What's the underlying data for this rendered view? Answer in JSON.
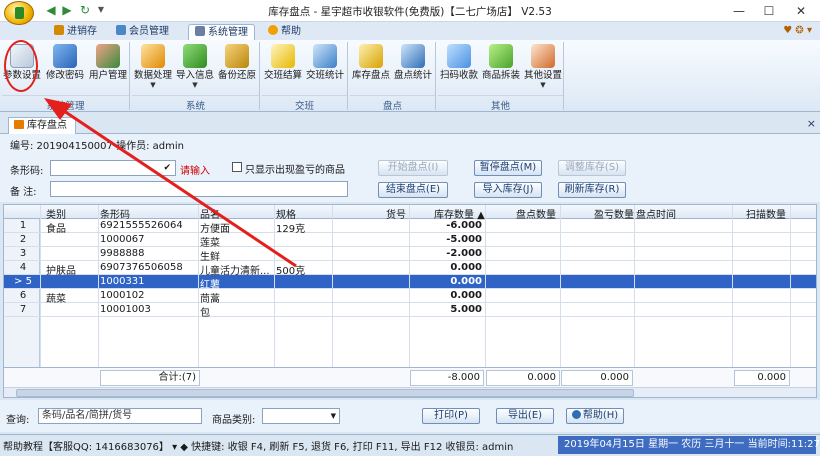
{
  "window": {
    "title": "库存盘点 - 星宇超市收银软件(免费版)【二七广场店】 V2.53",
    "minimize": "—",
    "maximize": "☐",
    "close": "✕"
  },
  "quick_access": [
    "◀",
    "▶",
    "↻",
    "▼"
  ],
  "tabs": [
    {
      "label": "进销存"
    },
    {
      "label": "会员管理"
    },
    {
      "label": "系统管理"
    },
    {
      "label": "帮助"
    }
  ],
  "tabs_right": "♥ ❂ ▾",
  "ribbon": {
    "groups": [
      {
        "label": "系统管理",
        "buttons": [
          "参数设置",
          "修改密码",
          "用户管理"
        ]
      },
      {
        "label": "系统",
        "buttons": [
          "数据处理",
          "导入信息",
          "备份还原"
        ]
      },
      {
        "label": "交班",
        "buttons": [
          "交班结算",
          "交班统计"
        ]
      },
      {
        "label": "盘点",
        "buttons": [
          "库存盘点",
          "盘点统计"
        ]
      },
      {
        "label": "其他",
        "buttons": [
          "扫码收款",
          "商品拆装",
          "其他设置"
        ]
      }
    ]
  },
  "doc_tab": {
    "label": "库存盘点",
    "close": "×"
  },
  "info": {
    "line": "编号: 201904150007   操作员: admin"
  },
  "form": {
    "barcode_label": "条形码:",
    "barcode_value": "",
    "barcode_hint": "请输入",
    "only_diff_label": "只显示出现盈亏的商品",
    "note_label": "备  注:",
    "note_value": "",
    "btn_start": "开始盘点(I)",
    "btn_pause": "暂停盘点(M)",
    "btn_adjust": "调整库存(S)",
    "btn_finish": "结束盘点(E)",
    "btn_import": "导入库存(J)",
    "btn_refresh": "刷新库存(R)"
  },
  "grid": {
    "columns": [
      "类别",
      "条形码",
      "品名",
      "规格",
      "货号",
      "库存数量 ▲",
      "盘点数量",
      "盈亏数量",
      "盘点时间",
      "扫描数量"
    ],
    "rows": [
      {
        "no": "1",
        "category": "食品",
        "barcode": "6921555526064",
        "name": "方便面",
        "spec": "129克",
        "code": "",
        "stock": "-6.000",
        "check": "",
        "diff": "",
        "time": "",
        "scan": ""
      },
      {
        "no": "2",
        "category": "",
        "barcode": "1000067",
        "name": "莲菜",
        "spec": "",
        "code": "",
        "stock": "-5.000",
        "check": "",
        "diff": "",
        "time": "",
        "scan": ""
      },
      {
        "no": "3",
        "category": "",
        "barcode": "9988888",
        "name": "生鲜",
        "spec": "",
        "code": "",
        "stock": "-2.000",
        "check": "",
        "diff": "",
        "time": "",
        "scan": ""
      },
      {
        "no": "4",
        "category": "护肤品",
        "barcode": "6907376506058",
        "name": "儿童活力清新...",
        "spec": "500克",
        "code": "",
        "stock": "0.000",
        "check": "",
        "diff": "",
        "time": "",
        "scan": ""
      },
      {
        "no": "5",
        "category": "",
        "barcode": "1000331",
        "name": "红薯",
        "spec": "",
        "code": "",
        "stock": "0.000",
        "check": "",
        "diff": "",
        "time": "",
        "scan": ""
      },
      {
        "no": "6",
        "category": "蔬菜",
        "barcode": "1000102",
        "name": "茼蒿",
        "spec": "",
        "code": "",
        "stock": "0.000",
        "check": "",
        "diff": "",
        "time": "",
        "scan": ""
      },
      {
        "no": "7",
        "category": "",
        "barcode": "10001003",
        "name": "包",
        "spec": "",
        "code": "",
        "stock": "5.000",
        "check": "",
        "diff": "",
        "time": "",
        "scan": ""
      }
    ],
    "selected_marker": "> 5",
    "footer": {
      "total_label": "合计:(7)",
      "stock_total": "-8.000",
      "check_total": "0.000",
      "diff_total": "0.000",
      "scan_total": "0.000"
    }
  },
  "query": {
    "label": "查询:",
    "value": "条码/品名/简拼/货号",
    "category_label": "商品类别:",
    "category_value": "",
    "btn_print": "打印(P)",
    "btn_export": "导出(E)",
    "btn_help": "帮助(H)"
  },
  "status": {
    "left": "帮助教程【客服QQ: 1416683076】 ▾  ◆  快捷键: 收银 F4, 刷新 F5, 退货 F6, 打印 F11, 导出 F12  收银员: admin",
    "right": "2019年04月15日 星期一 农历 三月十一 当前时间:11:27:11"
  }
}
